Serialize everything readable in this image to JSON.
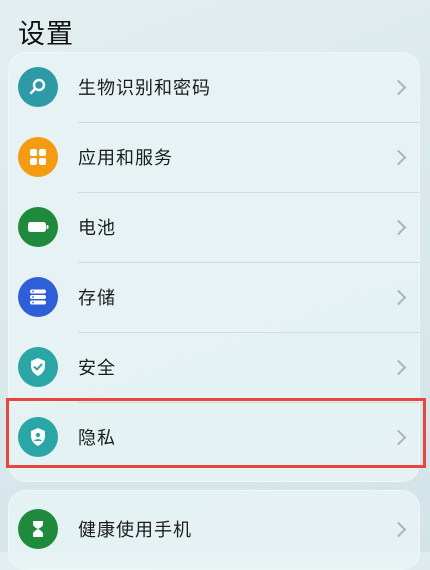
{
  "header": {
    "title": "设置"
  },
  "items": [
    {
      "label": "生物识别和密码",
      "icon": "key-icon",
      "color": "#2d9aa6"
    },
    {
      "label": "应用和服务",
      "icon": "apps-grid-icon",
      "color": "#f39c12"
    },
    {
      "label": "电池",
      "icon": "battery-icon",
      "color": "#1f8a3b"
    },
    {
      "label": "存储",
      "icon": "storage-icon",
      "color": "#2f5fd7"
    },
    {
      "label": "安全",
      "icon": "shield-check-icon",
      "color": "#2aa6a6"
    },
    {
      "label": "隐私",
      "icon": "privacy-shield-icon",
      "color": "#2aa6a6"
    },
    {
      "label": "健康使用手机",
      "icon": "hourglass-icon",
      "color": "#1f8a3b"
    }
  ],
  "highlight_color": "#e8453c"
}
